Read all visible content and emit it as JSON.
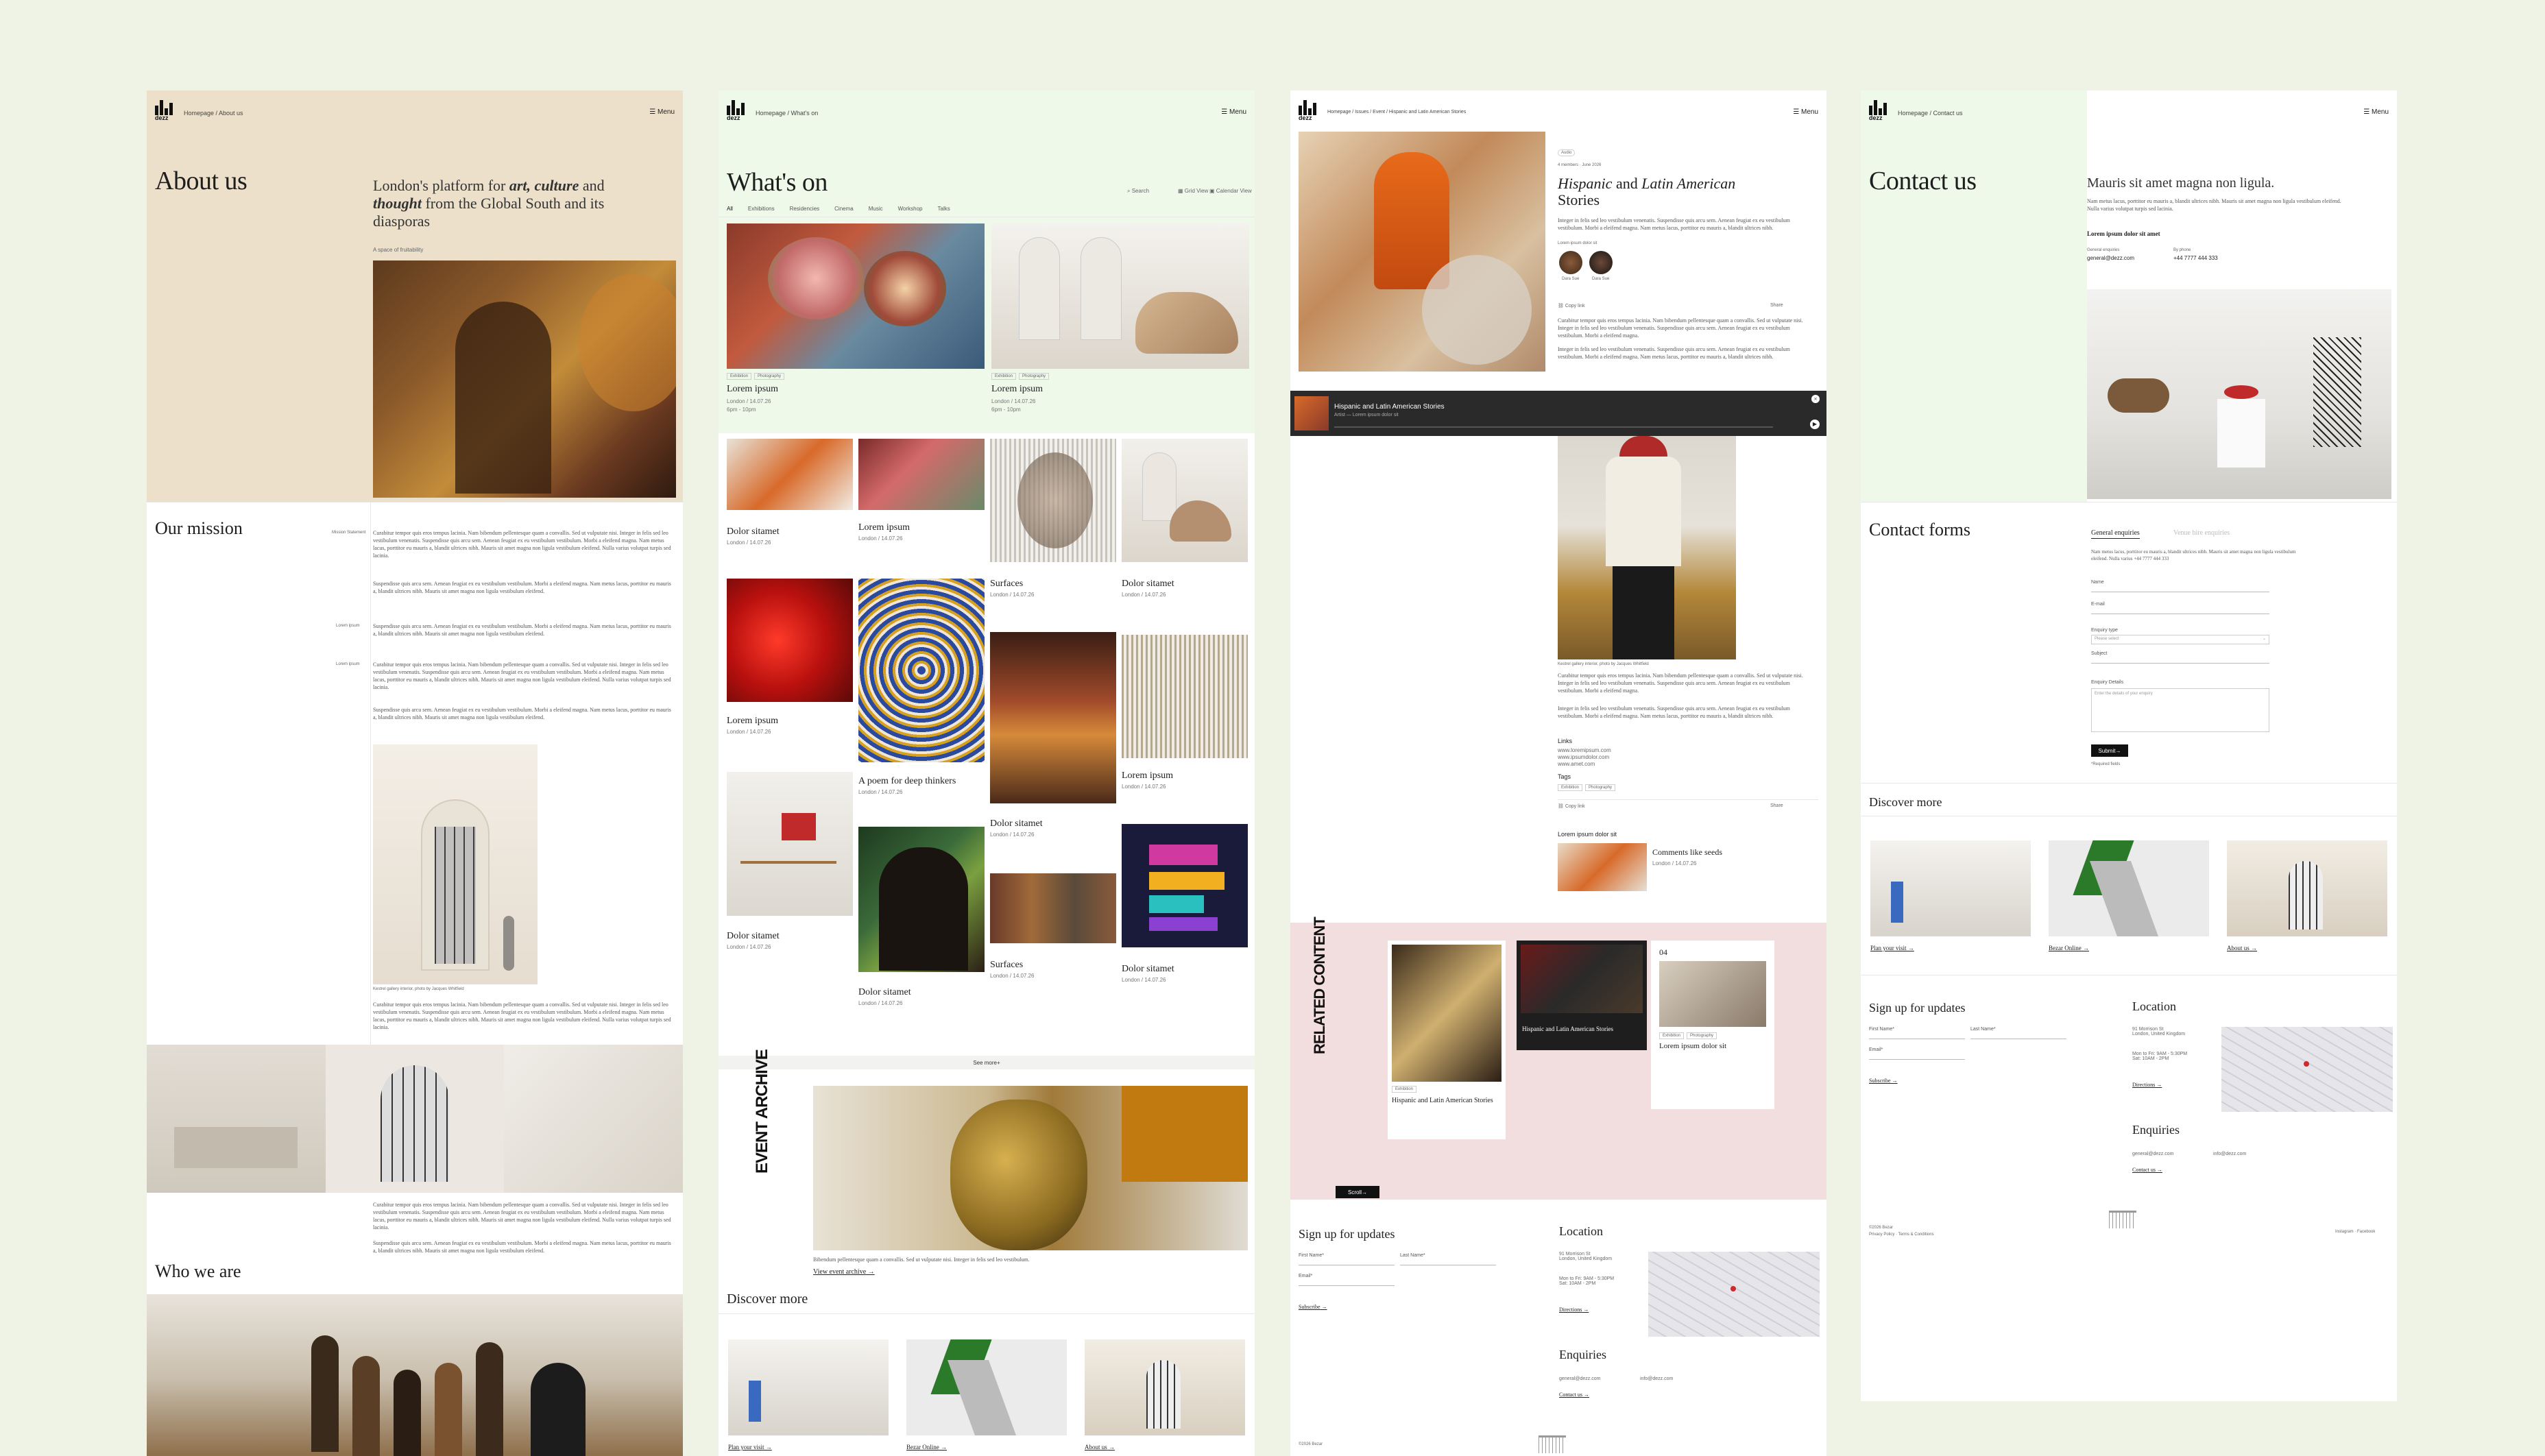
{
  "brand": {
    "logo_text": "dezz"
  },
  "header": {
    "menu_label": "Menu"
  },
  "p1": {
    "crumb": "Homepage / About us",
    "title": "About us",
    "tagline_pre": "London's platform for ",
    "tagline_em": "art, culture",
    "tagline_and": " and ",
    "tagline_em2": "thought",
    "tagline_post": " from the Global South and its diasporas",
    "kicker": "A space of fruitability",
    "mission_title": "Our mission",
    "mission_side": "Mission Statement",
    "mission_p1": "Curabitur tempor quis eros tempus lacinia. Nam bibendum pellentesque quam a convallis. Sed ut vulputate nisi. Integer in felis sed leo vestibulum venenatis. Suspendisse quis arcu sem. Aenean feugiat ex eu vestibulum vestibulum. Morbi a eleifend magna. Nam metus lacus, porttitor eu mauris a, blandit ultrices nibh. Mauris sit amet magna non ligula vestibulum eleifend. Nulla varius volutpat turpis sed lacinia.",
    "mission_p2": "Suspendisse quis arcu sem. Aenean feugiat ex eu vestibulum vestibulum. Morbi a eleifend magna. Nam metus lacus, porttitor eu mauris a, blandit ultrices nibh. Mauris sit amet magna non ligula vestibulum eleifend.",
    "side_label1": "Lorem ipsum",
    "side_label2": "Lorem ipsum",
    "caption": "Kestrel gallery interior, photo by Jacques Whitfield",
    "who_title": "Who we are"
  },
  "p2": {
    "crumb": "Homepage / What's on",
    "title": "What's on",
    "search": "Search",
    "grid_view": "Grid View",
    "calendar_view": "Calendar View",
    "tabs": [
      "All",
      "Exhibitions",
      "Residencies",
      "Cinema",
      "Music",
      "Workshop",
      "Talks"
    ],
    "featured": [
      {
        "title": "Lorem ipsum",
        "meta": "London / 14.07.26",
        "time": "6pm - 10pm",
        "tag1": "Exhibition",
        "tag2": "Photography"
      },
      {
        "title": "Lorem ipsum",
        "meta": "London / 14.07.26",
        "time": "6pm - 10pm",
        "tag1": "Exhibition",
        "tag2": "Photography"
      }
    ],
    "cards": [
      {
        "title": "Dolor sitamet",
        "meta": "London / 14.07.26"
      },
      {
        "title": "Lorem ipsum",
        "meta": "London / 14.07.26"
      },
      {
        "title": "Surfaces",
        "meta": "London / 14.07.26"
      },
      {
        "title": "Dolor sitamet",
        "meta": "London / 14.07.26"
      },
      {
        "title": "Lorem ipsum",
        "meta": "London / 14.07.26"
      },
      {
        "title": "A poem for deep thinkers",
        "meta": "London / 14.07.26"
      },
      {
        "title": "Dolor sitamet",
        "meta": "London / 14.07.26"
      },
      {
        "title": "Lorem ipsum",
        "meta": "London / 14.07.26"
      },
      {
        "title": "Dolor sitamet",
        "meta": "London / 14.07.26"
      },
      {
        "title": "Dolor sitamet",
        "meta": "London / 14.07.26"
      },
      {
        "title": "Surfaces",
        "meta": "London / 14.07.26"
      },
      {
        "title": "Dolor sitamet",
        "meta": "London / 14.07.26"
      }
    ],
    "see_more": "See more",
    "archive_label": "EVENT ARCHIVE",
    "archive_text": "Bibendum pellentesque quam a convallis. Sed ut vulputate nisi. Integer in felis sed leo vestibulum.",
    "archive_link": "View event archive",
    "discover_title": "Discover more",
    "discover": [
      "Plan your visit",
      "Bezar Online",
      "About us"
    ]
  },
  "p3": {
    "crumb": "Homepage / Issues / Event / Hispanic and Latin American Stories",
    "badge": "Audio",
    "meta": "4 members · June 2026",
    "title_em": "Hispanic",
    "title_mid": " and ",
    "title_em2": "Latin American",
    "title_post": " Stories",
    "intro": "Integer in felis sed leo vestibulum venenatis. Suspendisse quis arcu sem. Aenean feugiat ex eu vestibulum vestibulum. Morbi a eleifend magna. Nam metus lacus, porttitor eu mauris a, blandit ultrices nibh.",
    "people_label": "Lorem ipsum dolor sit",
    "person1": "Dara Sue",
    "person2": "Dara Sue",
    "copy_link": "Copy link",
    "share": "Share",
    "player_title": "Hispanic and Latin American Stories",
    "player_sub": "Artist — Lorem ipsum dolor sit",
    "body": "Curabitur tempor quis eros tempus lacinia. Nam bibendum pellentesque quam a convallis. Sed ut vulputate nisi. Integer in felis sed leo vestibulum venenatis. Suspendisse quis arcu sem. Aenean feugiat ex eu vestibulum vestibulum. Morbi a eleifend magna.",
    "links_title": "Links",
    "link1": "www.loremipsum.com",
    "link2": "www.ipsumdolor.com",
    "link3": "www.amet.com",
    "tags_title": "Tags",
    "related_head": "Lorem ipsum dolor sit",
    "related_title": "Comments like seeds",
    "related_meta": "London / 14.07.26",
    "related_label": "RELATED CONTENT",
    "rc1_title": "Hispanic and Latin American Stories",
    "rc2_title": "Hispanic and Latin American Stories",
    "rc3_num": "04",
    "rc3_title": "Lorem ipsum dolor sit",
    "scroll_btn": "Scroll",
    "signup_title": "Sign up for updates",
    "first_name": "First Name*",
    "last_name": "Last Name*",
    "email": "Email*",
    "subscribe": "Subscribe",
    "location_title": "Location",
    "address": "91 Morrison St\nLondon, United Kingdom",
    "hours": "Mon to Fri: 9AM - 5:30PM\nSat: 10AM - 2PM",
    "directions": "Directions",
    "enquiries_title": "Enquiries",
    "enq_general": "general@dezz.com",
    "enq_info": "info@dezz.com",
    "contact_us": "Contact us",
    "copyright": "©2026 Bezar"
  },
  "p4": {
    "crumb": "Homepage / Contact us",
    "title": "Contact us",
    "lead": "Mauris sit amet magna non ligula.",
    "lead_body": "Nam metus lacus, porttitor eu mauris a, blandit ultrices nibh. Mauris sit amet magna non ligula vestibulum eleifend. Nulla varius volutpat turpis sed lacinia.",
    "subhead": "Lorem ipsum dolor sit amet",
    "gen_label": "General enquiries",
    "gen_email": "general@dezz.com",
    "phone_label": "By phone",
    "phone": "+44 7777 444 333",
    "forms_title": "Contact forms",
    "tab1": "General enquiries",
    "tab2": "Venue hire enquiries",
    "form_intro": "Nam metus lacus, porttitor eu mauris a, blandit ultrices nibh. Mauris sit amet magna non ligula vestibulum eleifend. Nulla varius +44 7777 444 333",
    "f_name": "Name",
    "f_email": "E-mail",
    "f_type": "Enquiry type",
    "f_type_ph": "Please select",
    "f_subject": "Subject",
    "f_details": "Enquiry Details",
    "f_details_ph": "Enter the details of your enquiry",
    "submit": "Submit",
    "required": "*Required fields",
    "discover_title": "Discover more",
    "discover": [
      "Plan your visit",
      "Bezar Online",
      "About us"
    ],
    "signup_title": "Sign up for updates",
    "first_name": "First Name*",
    "last_name": "Last Name*",
    "email": "Email*",
    "subscribe": "Subscribe",
    "location_title": "Location",
    "address": "91 Morrison St\nLondon, United Kingdom",
    "hours": "Mon to Fri: 9AM - 5:30PM\nSat: 10AM - 2PM",
    "directions": "Directions",
    "enquiries_title": "Enquiries",
    "enq_general": "general@dezz.com",
    "enq_info": "info@dezz.com",
    "contact_us": "Contact us",
    "copyright": "©2026 Bezar",
    "legal": "Privacy Policy · Terms & Conditions",
    "social": "Instagram · Facebook"
  }
}
